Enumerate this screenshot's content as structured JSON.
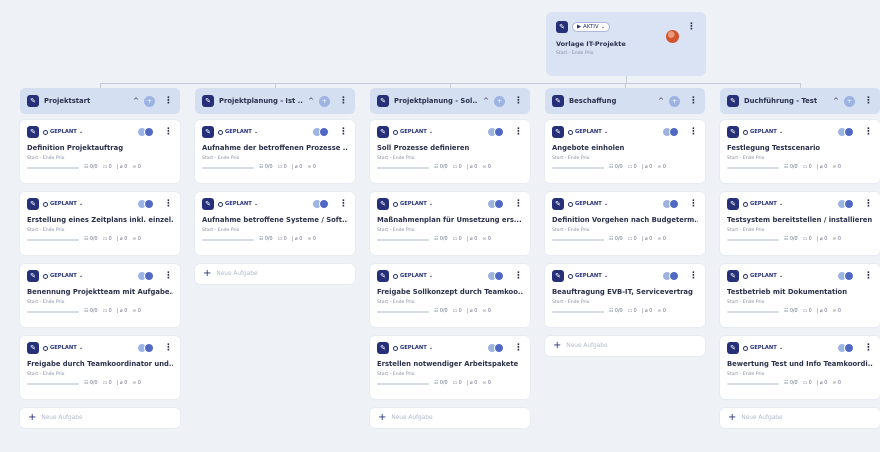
{
  "root": {
    "status": "▶ AKTIV",
    "title": "Vorlage IT-Projekte",
    "meta": "Start - Ende   Prio"
  },
  "new_task_label": "Neue Aufgabe",
  "columns": [
    {
      "title": "Projektstart",
      "tasks": [
        {
          "status": "GEPLANT",
          "title": "Definition Projektauftrag",
          "meta": "Start - Ende   Prio",
          "subtasks": "0/0",
          "comments": "0",
          "attachments": "0",
          "links": "0"
        },
        {
          "status": "GEPLANT",
          "title": "Erstellung eines Zeitplans inkl. einzel...",
          "meta": "Start - Ende   Prio",
          "subtasks": "0/0",
          "comments": "0",
          "attachments": "0",
          "links": "0"
        },
        {
          "status": "GEPLANT",
          "title": "Benennung Projektteam mit Aufgabe...",
          "meta": "Start - Ende   Prio",
          "subtasks": "0/0",
          "comments": "0",
          "attachments": "0",
          "links": "0"
        },
        {
          "status": "GEPLANT",
          "title": "Freigabe durch Teamkoordinator und...",
          "meta": "Start - Ende   Prio",
          "subtasks": "0/0",
          "comments": "0",
          "attachments": "0",
          "links": "0"
        }
      ]
    },
    {
      "title": "Projektplanung - Ist ...",
      "tasks": [
        {
          "status": "GEPLANT",
          "title": "Aufnahme der betroffenen Prozesse ...",
          "meta": "Start - Ende   Prio",
          "subtasks": "0/0",
          "comments": "0",
          "attachments": "0",
          "links": "0"
        },
        {
          "status": "GEPLANT",
          "title": "Aufnahme betroffene Systeme / Soft...",
          "meta": "Start - Ende   Prio",
          "subtasks": "0/0",
          "comments": "0",
          "attachments": "0",
          "links": "0"
        }
      ]
    },
    {
      "title": "Projektplanung - Sol...",
      "tasks": [
        {
          "status": "GEPLANT",
          "title": "Soll Prozesse definieren",
          "meta": "Start - Ende   Prio",
          "subtasks": "0/0",
          "comments": "0",
          "attachments": "0",
          "links": "0"
        },
        {
          "status": "GEPLANT",
          "title": "Maßnahmenplan für Umsetzung ers...",
          "meta": "Start - Ende   Prio",
          "subtasks": "0/0",
          "comments": "0",
          "attachments": "0",
          "links": "0"
        },
        {
          "status": "GEPLANT",
          "title": "Freigabe Sollkonzept durch Teamkoo...",
          "meta": "Start - Ende   Prio",
          "subtasks": "0/0",
          "comments": "0",
          "attachments": "0",
          "links": "0"
        },
        {
          "status": "GEPLANT",
          "title": "Erstellen notwendiger Arbeitspakete",
          "meta": "Start - Ende   Prio",
          "subtasks": "0/0",
          "comments": "0",
          "attachments": "0",
          "links": "0"
        }
      ]
    },
    {
      "title": "Beschaffung",
      "tasks": [
        {
          "status": "GEPLANT",
          "title": "Angebote einholen",
          "meta": "Start - Ende   Prio",
          "subtasks": "0/0",
          "comments": "0",
          "attachments": "0",
          "links": "0"
        },
        {
          "status": "GEPLANT",
          "title": "Definition Vorgehen nach Budgeterm...",
          "meta": "Start - Ende   Prio",
          "subtasks": "0/0",
          "comments": "0",
          "attachments": "0",
          "links": "0"
        },
        {
          "status": "GEPLANT",
          "title": "Beauftragung EVB-IT, Servicevertrag",
          "meta": "Start - Ende   Prio",
          "subtasks": "0/0",
          "comments": "0",
          "attachments": "0",
          "links": "0"
        }
      ]
    },
    {
      "title": "Duchführung - Test",
      "tasks": [
        {
          "status": "GEPLANT",
          "title": "Festlegung Testscenario",
          "meta": "Start - Ende   Prio",
          "subtasks": "0/0",
          "comments": "0",
          "attachments": "0",
          "links": "0"
        },
        {
          "status": "GEPLANT",
          "title": "Testsystem bereitstellen / installieren",
          "meta": "Start - Ende   Prio",
          "subtasks": "0/0",
          "comments": "0",
          "attachments": "0",
          "links": "0"
        },
        {
          "status": "GEPLANT",
          "title": "Testbetrieb mit Dokumentation",
          "meta": "Start - Ende   Prio",
          "subtasks": "0/0",
          "comments": "0",
          "attachments": "0",
          "links": "0"
        },
        {
          "status": "GEPLANT",
          "title": "Bewertung Test und Info Teamkoordi...",
          "meta": "Start - Ende   Prio",
          "subtasks": "0/0",
          "comments": "0",
          "attachments": "0",
          "links": "0"
        }
      ]
    }
  ],
  "icons": {
    "edit": "pencil-icon",
    "menu": "kebab-menu-icon",
    "collapse": "chevron-up-icon",
    "dropdown": "chevron-down-icon",
    "subtasks": "subtasks-icon",
    "comments": "comment-icon",
    "attachments": "paperclip-icon",
    "links": "link-icon"
  },
  "colors": {
    "background": "#eef1f6",
    "header": "#d4dff2",
    "accent": "#263078"
  }
}
